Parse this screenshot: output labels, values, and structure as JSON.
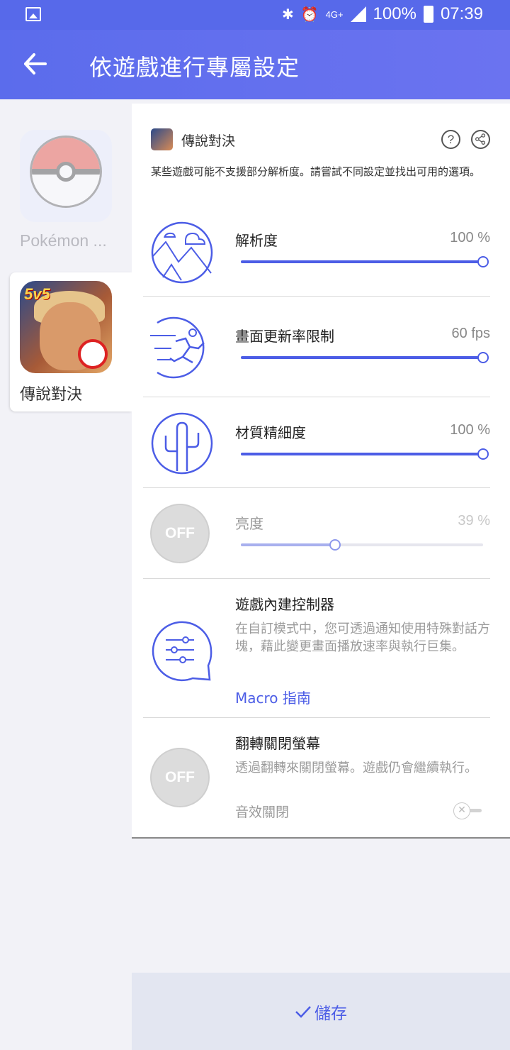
{
  "status_bar": {
    "battery": "100%",
    "time": "07:39",
    "network": "4G+"
  },
  "app_bar": {
    "title": "依遊戲進行專屬設定"
  },
  "sidebar": {
    "apps": [
      {
        "label": "Pokémon ...",
        "selected": false
      },
      {
        "label": "傳說對決",
        "selected": true
      }
    ]
  },
  "panel": {
    "game_name": "傳說對決",
    "note": "某些遊戲可能不支援部分解析度。請嘗試不同設定並找出可用的選項。",
    "settings": {
      "resolution": {
        "label": "解析度",
        "value_text": "100 %",
        "value": 100,
        "max": 100
      },
      "frame_rate": {
        "label": "畫面更新率限制",
        "value_text": "60 fps",
        "value": 60,
        "max": 60
      },
      "texture": {
        "label": "材質精細度",
        "value_text": "100 %",
        "value": 100,
        "max": 100
      },
      "brightness": {
        "label": "亮度",
        "value_text": "39 %",
        "value": 39,
        "max": 100,
        "icon_text": "OFF"
      },
      "controller": {
        "label": "遊戲內建控制器",
        "description": "在自訂模式中，您可透過通知使用特殊對話方塊，藉此變更畫面播放速率與執行巨集。",
        "link": "Macro 指南"
      },
      "flip": {
        "label": "翻轉關閉螢幕",
        "description": "透過翻轉來關閉螢幕。遊戲仍會繼續執行。",
        "sound_label": "音效關閉",
        "sound_on": false,
        "icon_text": "OFF"
      }
    }
  },
  "footer": {
    "save_label": "儲存"
  },
  "colors": {
    "accent": "#4c5de6",
    "appbar": "#5b6cec"
  }
}
